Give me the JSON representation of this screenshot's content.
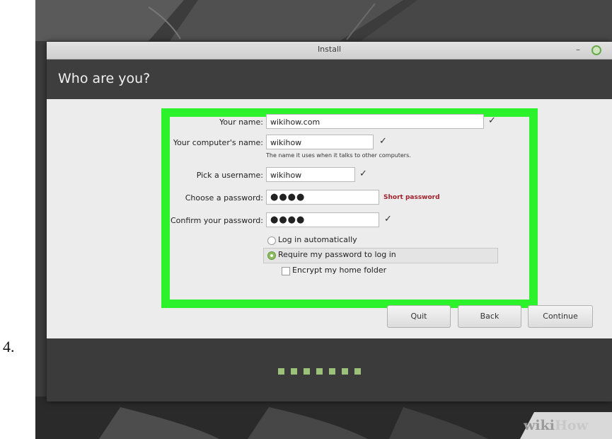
{
  "step_number": "4.",
  "window": {
    "title": "Install",
    "minimize_glyph": "–",
    "page_title": "Who are you?"
  },
  "form": {
    "your_name_label": "Your name:",
    "your_name_value": "wikihow.com",
    "computer_name_label": "Your computer's name:",
    "computer_name_value": "wikihow",
    "computer_name_hint": "The name it uses when it talks to other computers.",
    "username_label": "Pick a username:",
    "username_value": "wikihow",
    "password_label": "Choose a password:",
    "password_value": "●●●●",
    "password_strength": "Short password",
    "confirm_label": "Confirm your password:",
    "confirm_value": "●●●●",
    "check_glyph": "✓",
    "option_auto_login": "Log in automatically",
    "option_require_password": "Require my password to log in",
    "option_encrypt": "Encrypt my home folder"
  },
  "buttons": {
    "quit": "Quit",
    "back": "Back",
    "continue": "Continue"
  },
  "progress": {
    "total_steps": 7,
    "color": "#9cc27a"
  },
  "watermark": {
    "part1": "wiki",
    "part2": "How"
  },
  "colors": {
    "highlight": "#2cf22c",
    "warning": "#a0202b",
    "accent": "#8bbd5f"
  }
}
